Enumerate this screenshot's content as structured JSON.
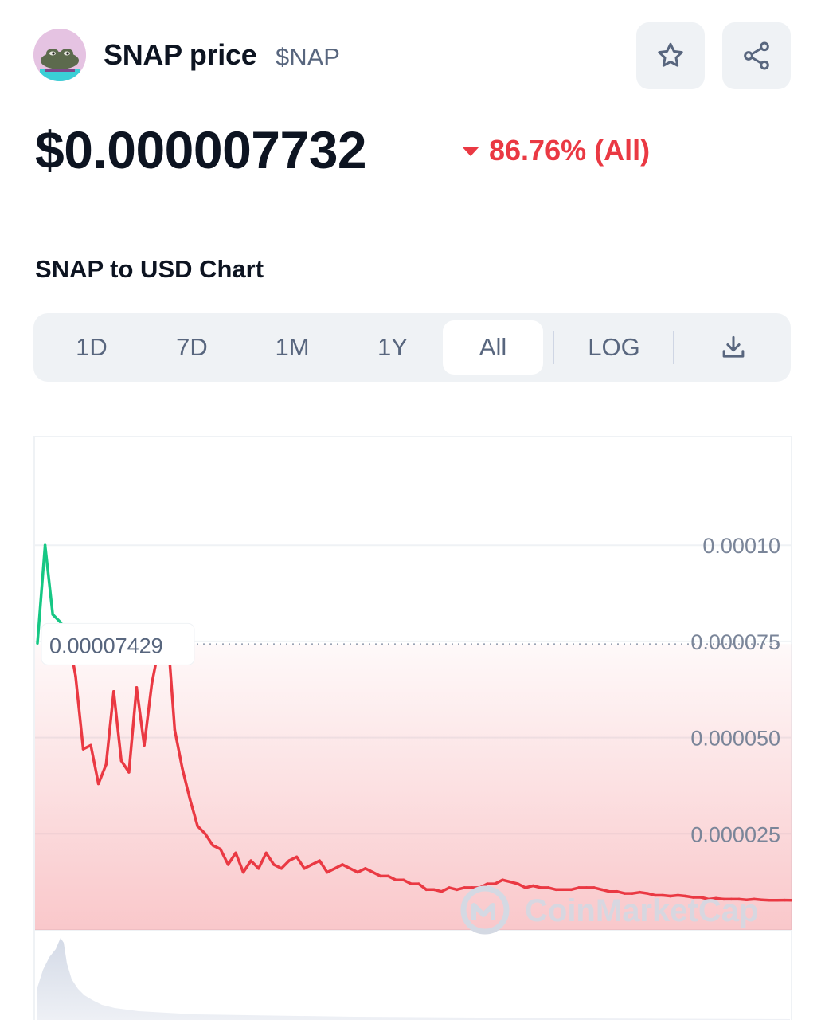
{
  "coin": {
    "name": "SNAP price",
    "symbol": "$NAP",
    "avatar_icon": "frog-avatar-icon"
  },
  "actions": {
    "favorite_icon": "star-icon",
    "share_icon": "share-icon"
  },
  "price": {
    "value": "$0.000007732",
    "change": "86.76% (All)",
    "change_direction": "down",
    "change_color": "#ea3943"
  },
  "chart_section": {
    "title": "SNAP to USD Chart",
    "ranges": [
      "1D",
      "7D",
      "1M",
      "1Y",
      "All"
    ],
    "active_range": "All",
    "log_label": "LOG",
    "download_icon": "download-icon"
  },
  "chart_data": {
    "type": "area",
    "y_ticks": [
      "0.00010",
      "0.000075",
      "0.000050",
      "0.000025"
    ],
    "ylim": [
      0,
      0.000128
    ],
    "reference_label": "0.00007429",
    "reference_value": 7.429e-05,
    "watermark": "CoinMarketCap",
    "colors": {
      "up": "#16c784",
      "down": "#ea3943",
      "grid": "#eff2f5",
      "axis_text": "#7a8599"
    },
    "grid": true,
    "series": [
      {
        "values": [
          7.45e-05,
          0.0001,
          8.2e-05,
          8e-05,
          7.7e-05,
          6.6e-05,
          4.7e-05,
          4.8e-05,
          3.8e-05,
          4.3e-05,
          6.2e-05,
          4.4e-05,
          4.1e-05,
          6.3e-05,
          4.8e-05,
          6.4e-05,
          7.4e-05,
          7.9e-05,
          5.2e-05,
          4.2e-05,
          3.4e-05,
          2.7e-05,
          2.5e-05,
          2.2e-05,
          2.1e-05,
          1.7e-05,
          2e-05,
          1.5e-05,
          1.8e-05,
          1.6e-05,
          2e-05,
          1.7e-05,
          1.6e-05,
          1.8e-05,
          1.9e-05,
          1.6e-05,
          1.7e-05,
          1.8e-05,
          1.5e-05,
          1.6e-05,
          1.7e-05,
          1.6e-05,
          1.5e-05,
          1.6e-05,
          1.5e-05,
          1.4e-05,
          1.4e-05,
          1.3e-05,
          1.3e-05,
          1.2e-05,
          1.2e-05,
          1.05e-05,
          1.05e-05,
          1e-05,
          1.1e-05,
          1.05e-05,
          1.1e-05,
          1.1e-05,
          1.1e-05,
          1.2e-05,
          1.2e-05,
          1.3e-05,
          1.25e-05,
          1.2e-05,
          1.1e-05,
          1.15e-05,
          1.1e-05,
          1.1e-05,
          1.05e-05,
          1.05e-05,
          1.05e-05,
          1.1e-05,
          1.1e-05,
          1.1e-05,
          1.05e-05,
          1e-05,
          1e-05,
          9.5e-06,
          9.5e-06,
          9.8e-06,
          9.5e-06,
          9e-06,
          9e-06,
          8.8e-06,
          9e-06,
          8.8e-06,
          8.5e-06,
          8.5e-06,
          8e-06,
          8.2e-06,
          8e-06,
          8e-06,
          8e-06,
          7.8e-06,
          8e-06,
          7.8e-06,
          7.7e-06,
          7.7e-06,
          7.75e-06,
          7.732e-06
        ]
      }
    ]
  }
}
